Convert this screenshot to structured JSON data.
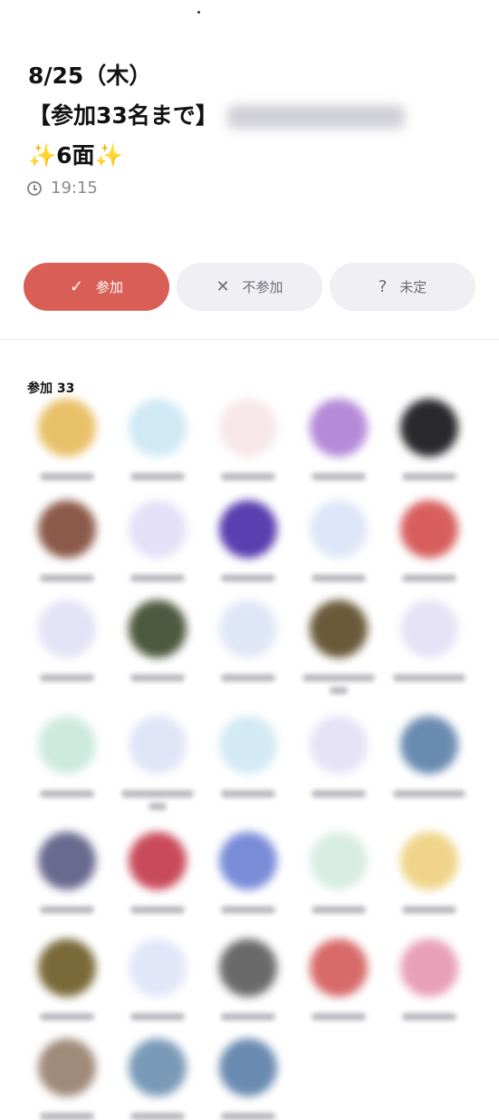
{
  "event": {
    "title_line1": "8/25（木）",
    "title_line2": "【参加33名まで】",
    "title_line3_spark_left": "✨",
    "title_line3_text": "6面",
    "title_line3_spark_right": "✨",
    "time": "19:15"
  },
  "response_buttons": {
    "join": {
      "icon": "✓",
      "label": "参加"
    },
    "decline": {
      "icon": "✕",
      "label": "不参加"
    },
    "undecided": {
      "icon": "?",
      "label": "未定"
    }
  },
  "participants": {
    "section_label": "参加 33",
    "count": 33
  },
  "colors": {
    "accent": "#d95f56",
    "button_inactive": "#efeff4",
    "secondary_text": "#8a8a8f"
  },
  "avatars": [
    "#e9c06a",
    "#cfe9f5",
    "#f7e6ea",
    "#b58ad8",
    "#2a2a2e",
    "#8c5a4a",
    "#e3e0f7",
    "#5a3fb0",
    "#dde6f8",
    "#d85e5e",
    "#e4e2f6",
    "#4d5a3f",
    "#dfe7f6",
    "#6b5a3a",
    "#e6e2f6",
    "#cdeadf",
    "#dfe5f7",
    "#d3e9f4",
    "#e5e2f6",
    "#6a8bb0",
    "#6a6a90",
    "#c94b5b",
    "#7a8cd8",
    "#d8ede2",
    "#efd48a",
    "#7a6a3a",
    "#e1e6f8",
    "#6a6a6a",
    "#d86a6a",
    "#e8a0b8",
    "#a08a7a",
    "#7a9ab8",
    "#6a8ab0"
  ]
}
